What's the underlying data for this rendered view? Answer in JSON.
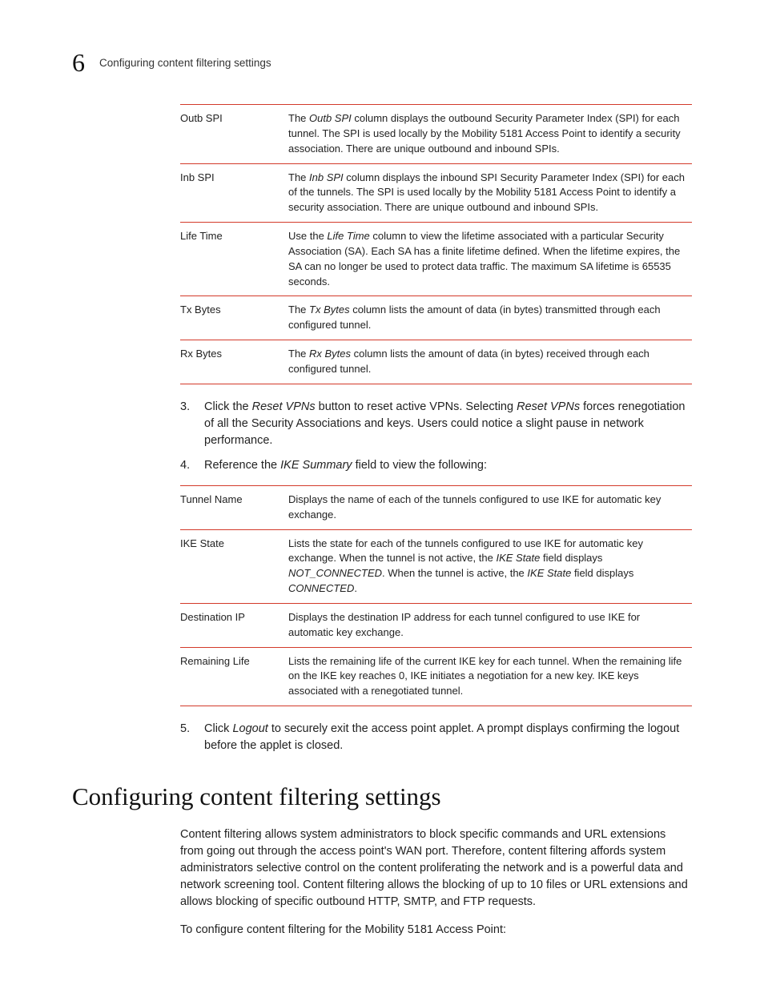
{
  "header": {
    "chapter": "6",
    "running_title": "Configuring content filtering settings"
  },
  "table1": {
    "rows": [
      {
        "term": "Outb SPI",
        "def_pre": "The ",
        "def_em1": "Outb SPI",
        "def_post": " column displays the outbound Security Parameter Index (SPI) for each tunnel. The SPI is used locally by the Mobility 5181 Access Point to identify a security association. There are unique outbound and inbound SPIs."
      },
      {
        "term": "Inb SPI",
        "def_pre": "The ",
        "def_em1": "Inb SPI",
        "def_post": " column displays the inbound SPI Security Parameter Index (SPI) for each of the tunnels. The SPI is used locally by the Mobility 5181 Access Point to identify a security association. There are unique outbound and inbound SPIs."
      },
      {
        "term": "Life Time",
        "def_pre": "Use the ",
        "def_em1": "Life Time",
        "def_post": " column to view the lifetime associated with a particular Security Association (SA). Each SA has a finite lifetime defined. When the lifetime expires, the SA can no longer be used to protect data traffic. The maximum SA lifetime is 65535 seconds."
      },
      {
        "term": "Tx Bytes",
        "def_pre": "The ",
        "def_em1": "Tx Bytes",
        "def_post": " column lists the amount of data (in bytes) transmitted through each configured tunnel."
      },
      {
        "term": "Rx Bytes",
        "def_pre": "The ",
        "def_em1": "Rx Bytes",
        "def_post": " column lists the amount of data (in bytes) received through each configured tunnel."
      }
    ]
  },
  "steps1": [
    {
      "num": "3.",
      "pre": "Click the ",
      "em1": "Reset VPNs",
      "mid": " button to reset active VPNs. Selecting ",
      "em2": "Reset VPNs",
      "post": " forces renegotiation of all the Security Associations and keys. Users could notice a slight pause in network performance."
    },
    {
      "num": "4.",
      "pre": "Reference the ",
      "em1": "IKE Summary",
      "mid": "",
      "em2": "",
      "post": " field to view the following:"
    }
  ],
  "table2": {
    "rows": [
      {
        "term": "Tunnel Name",
        "def": "Displays the name of each of the tunnels configured to use IKE for automatic key exchange."
      },
      {
        "term": "IKE State",
        "def_pre": "Lists the state for each of the tunnels configured to use IKE for automatic key exchange. When the tunnel is not active, the ",
        "def_em1": "IKE State",
        "def_mid": " field displays ",
        "def_em2": "NOT_CONNECTED",
        "def_mid2": ". When the tunnel is active, the ",
        "def_em3": "IKE State",
        "def_mid3": " field displays ",
        "def_em4": "CONNECTED",
        "def_post": "."
      },
      {
        "term": "Destination IP",
        "def": "Displays the destination IP address for each tunnel configured to use IKE for automatic key exchange."
      },
      {
        "term": "Remaining Life",
        "def": "Lists the remaining life of the current IKE key for each tunnel. When the remaining life on the IKE key reaches 0, IKE initiates a negotiation for a new key. IKE keys associated with a renegotiated tunnel."
      }
    ]
  },
  "steps2": [
    {
      "num": "5.",
      "pre": "Click ",
      "em1": "Logout",
      "post": " to securely exit the access point applet. A prompt displays confirming the logout before the applet is closed."
    }
  ],
  "section_heading": "Configuring content filtering settings",
  "para1": "Content filtering allows system administrators to block specific commands and URL extensions from going out through the access point's WAN port. Therefore, content filtering affords system administrators selective control on the content proliferating the network and is a powerful data and network screening tool. Content filtering allows the blocking of up to 10 files or URL extensions and allows blocking of specific outbound HTTP, SMTP, and FTP requests.",
  "para2": "To configure content filtering for the Mobility 5181 Access Point:"
}
